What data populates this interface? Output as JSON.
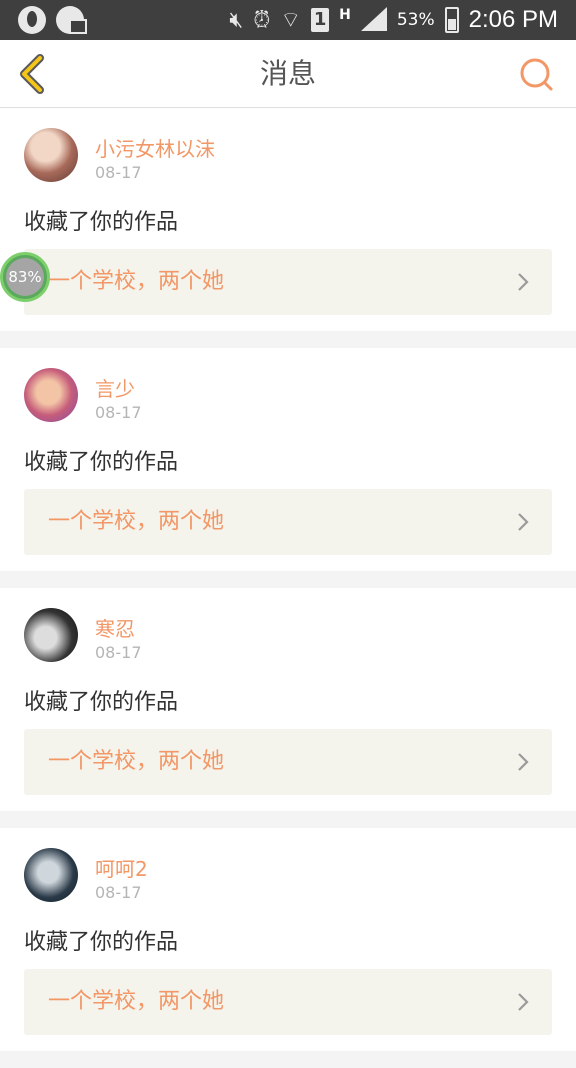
{
  "status_bar": {
    "battery": "53%",
    "time": "2:06 PM",
    "network": "H",
    "sim": "1"
  },
  "header": {
    "title": "消息",
    "back_icon": "back-chevron-icon",
    "search_icon": "search-icon",
    "accent_color": "#f29766",
    "back_color": "#f5c518"
  },
  "messages": [
    {
      "user": "小污女林以沫",
      "date": "08-17",
      "action": "收藏了你的作品",
      "work": "一个学校，两个她"
    },
    {
      "user": "言少",
      "date": "08-17",
      "action": "收藏了你的作品",
      "work": "一个学校，两个她"
    },
    {
      "user": "寒忍",
      "date": "08-17",
      "action": "收藏了你的作品",
      "work": "一个学校，两个她"
    },
    {
      "user": "呵呵2",
      "date": "08-17",
      "action": "收藏了你的作品",
      "work": "一个学校，两个她"
    }
  ],
  "overlay_badge": {
    "text": "83%",
    "percent": 83
  }
}
